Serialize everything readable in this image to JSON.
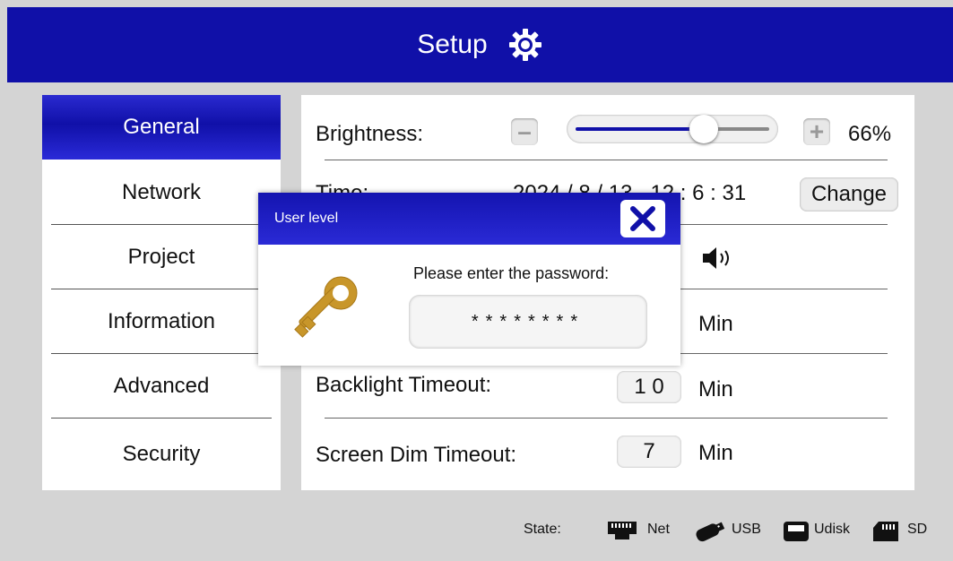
{
  "header": {
    "title": "Setup",
    "icon": "gear-icon"
  },
  "sidebar": {
    "items": [
      {
        "label": "General",
        "active": true
      },
      {
        "label": "Network"
      },
      {
        "label": "Project"
      },
      {
        "label": "Information"
      },
      {
        "label": "Advanced"
      },
      {
        "label": "Security"
      }
    ]
  },
  "settings": {
    "brightness": {
      "label": "Brightness:",
      "minus": "–",
      "plus": "+",
      "value_text": "66%",
      "level": 0.66
    },
    "time": {
      "label": "Time:",
      "value": "2024 / 8 / 13   12 : 6 : 31",
      "change_label": "Change"
    },
    "backlight": {
      "label": "Backlight Timeout:",
      "value": "1 0",
      "unit": "Min"
    },
    "screen_dim": {
      "label": "Screen Dim Timeout:",
      "value": "7",
      "unit": "Min"
    },
    "row3_unit": "Min"
  },
  "status": {
    "label": "State:",
    "items": [
      {
        "label": "Net",
        "icon": "ethernet-icon"
      },
      {
        "label": "USB",
        "icon": "usb-icon"
      },
      {
        "label": "Udisk",
        "icon": "udisk-icon"
      },
      {
        "label": "SD",
        "icon": "sd-card-icon"
      }
    ]
  },
  "dialog": {
    "title": "User level",
    "prompt": "Please enter the password:",
    "password_mask": "********",
    "icon": "key-icon"
  },
  "colors": {
    "primary": "#1010a8",
    "background": "#d4d4d4",
    "key": "#c8962a"
  }
}
